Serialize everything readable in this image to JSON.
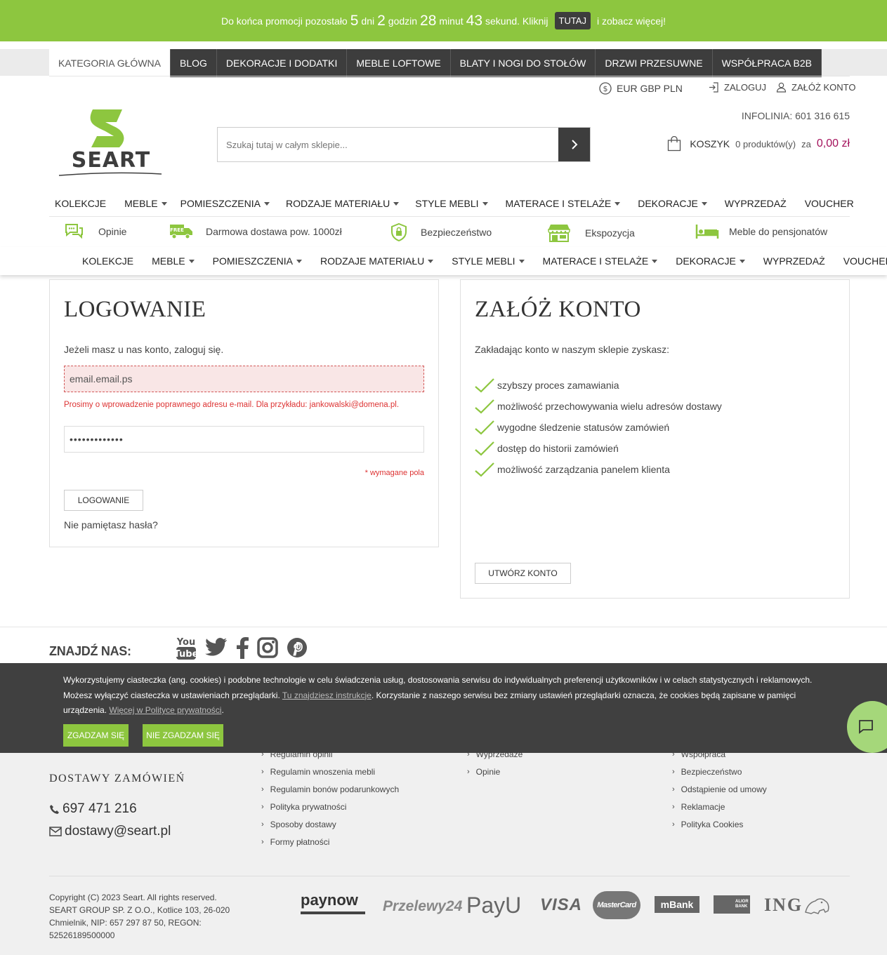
{
  "promo": {
    "text1": "Do końca promocji pozostało",
    "days": "5",
    "days_label": "dni",
    "hours": "2",
    "hours_label": "godzin",
    "minutes": "28",
    "minutes_label": "minut",
    "seconds": "43",
    "seconds_label": "sekund. Kliknij",
    "button": "TUTAJ",
    "text2": "i zobacz więcej!"
  },
  "tabs": [
    "KATEGORIA GŁÓWNA",
    "BLOG",
    "DEKORACJE I DODATKI",
    "MEBLE LOFTOWE",
    "BLATY I NOGI DO STOŁÓW",
    "DRZWI PRZESUWNE",
    "WSPÓŁPRACA B2B"
  ],
  "userbar": {
    "currency": "EUR GBP PLN",
    "login": "ZALOGUJ",
    "register": "ZAŁÓŻ KONTO"
  },
  "infolinia": "INFOLINIA: 601 316 615",
  "logo_text": "SEART",
  "search": {
    "placeholder": "Szukaj tutaj w całym sklepie..."
  },
  "cart": {
    "label": "KOSZYK",
    "count": "0 produktów(y)",
    "za": "za",
    "price": "0,00 zł"
  },
  "menu": [
    {
      "label": "KOLEKCJE",
      "dropdown": false
    },
    {
      "label": "MEBLE",
      "dropdown": true
    },
    {
      "label": "POMIESZCZENIA",
      "dropdown": true
    },
    {
      "label": "RODZAJE MATERIAŁU",
      "dropdown": true
    },
    {
      "label": "STYLE MEBLI",
      "dropdown": true
    },
    {
      "label": "MATERACE I STELAŻE",
      "dropdown": true
    },
    {
      "label": "DEKORACJE",
      "dropdown": true
    },
    {
      "label": "WYPRZEDAŻ",
      "dropdown": false
    },
    {
      "label": "VOUCHER",
      "dropdown": false
    }
  ],
  "features": [
    "Opinie",
    "Darmowa dostawa pow. 1000zł",
    "Bezpieczeństwo",
    "Ekspozycja",
    "Meble do pensjonatów"
  ],
  "login": {
    "title": "LOGOWANIE",
    "intro": "Jeżeli masz u nas konto, zaloguj się.",
    "email_value": "email.email.ps",
    "email_error": "Prosimy o wprowadzenie poprawnego adresu e-mail. Dla przykładu: jankowalski@domena.pl.",
    "password_value": "•••••••••••••",
    "required": "* wymagane pola",
    "button": "LOGOWANIE",
    "forgot": "Nie pamiętasz hasła?"
  },
  "register": {
    "title": "ZAŁÓŻ KONTO",
    "intro": "Zakładając konto w naszym sklepie zyskasz:",
    "benefits": [
      "szybszy proces zamawiania",
      "możliwość przechowywania wielu adresów dostawy",
      "wygodne śledzenie statusów zamówień",
      "dostęp do historii zamówień",
      "możliwość zarządzania panelem klienta"
    ],
    "button": "UTWÓRZ KONTO"
  },
  "footer": {
    "find_us": "ZNAJDŹ NAS:",
    "deliveries": "DOSTAWY ZAMÓWIEŃ",
    "phone": "697 471 216",
    "email": "dostawy@seart.pl",
    "col2": [
      "Regulamin opinii",
      "Regulamin wnoszenia mebli",
      "Regulamin bonów podarunkowych",
      "Polityka prywatności",
      "Sposoby dostawy",
      "Formy płatności"
    ],
    "col3": [
      "Wyprzedaże",
      "Opinie"
    ],
    "col4": [
      "Współpraca",
      "Bezpieczeństwo",
      "Odstąpienie od umowy",
      "Reklamacje",
      "Polityka Cookies"
    ],
    "copyright": "Copyright (C) 2023 Seart. All rights reserved. SEART GROUP SP. Z O.O., Kotlice 103, 26-020 Chmielnik, NIP: 657 297 87 50, REGON: 52526189500000",
    "payments": [
      "paynow",
      "Przelewy24",
      "PayU",
      "VISA",
      "MasterCard",
      "mBank",
      "ALIOR BANK",
      "ING"
    ]
  },
  "cookie": {
    "text1": "Wykorzystujemy ciasteczka (ang. cookies) i podobne technologie w celu świadczenia usług, dostosowania serwisu do indywidualnych preferencji użytkowników i w celach statystycznych i reklamowych. Możesz wyłączyć ciasteczka w ustawieniach przeglądarki.",
    "link1": "Tu znajdziesz instrukcje",
    "text2": ". Korzystanie z naszego serwisu bez zmiany ustawień przeglądarki oznacza, że cookies będą zapisane w pamięci urządzenia.",
    "link2": "Więcej w Polityce prywatności",
    "text3": ".",
    "accept": "ZGADZAM SIĘ",
    "reject": "NIE ZGADZAM SIĘ"
  },
  "colors": {
    "brand_green": "#8dc63f",
    "dark": "#3d3d3d",
    "price": "#a4125c",
    "error": "#dd3333"
  }
}
